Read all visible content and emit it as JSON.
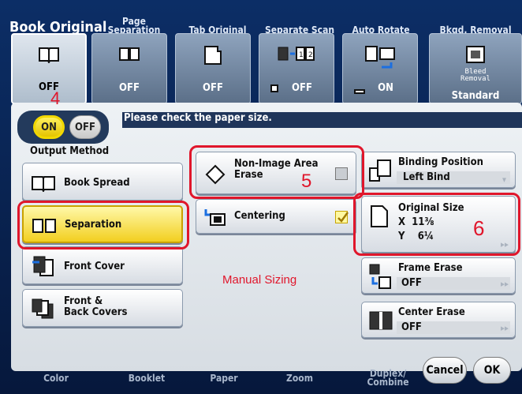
{
  "tabs": {
    "titles": [
      {
        "label": "Book Original"
      },
      {
        "label": "Page\nSeparation"
      },
      {
        "label": "Tab Original"
      },
      {
        "label": "Separate Scan"
      },
      {
        "label": "Auto Rotate"
      },
      {
        "label": "Bkgd. Removal"
      }
    ],
    "buttons": [
      {
        "state": "OFF",
        "icon": "book-icon"
      },
      {
        "state": "OFF",
        "icon": "page-separation-icon"
      },
      {
        "state": "OFF",
        "icon": "tab-original-icon"
      },
      {
        "state": "OFF",
        "icon": "separate-scan-icon"
      },
      {
        "state": "ON",
        "icon": "auto-rotate-icon"
      },
      {
        "state": "Standard",
        "icon": "bleed-removal-icon",
        "sublabel": "Bleed\nRemoval"
      }
    ]
  },
  "toggle": {
    "on": "ON",
    "off": "OFF"
  },
  "message": "Please check the paper size.",
  "output_method": {
    "label": "Output Method",
    "items": [
      {
        "label": "Book Spread"
      },
      {
        "label": "Separation"
      },
      {
        "label": "Front Cover"
      },
      {
        "label": "Front &\nBack Covers"
      }
    ]
  },
  "center": {
    "non_image_area_erase": "Non-Image Area\nErase",
    "centering": "Centering",
    "manual_sizing": "Manual Sizing"
  },
  "right": {
    "binding_position": {
      "title": "Binding Position",
      "value": "Left Bind"
    },
    "original_size": {
      "title": "Original Size",
      "x": "X  11⅜",
      "y": "Y    6¼"
    },
    "frame_erase": {
      "title": "Frame Erase",
      "value": "OFF"
    },
    "center_erase": {
      "title": "Center Erase",
      "value": "OFF"
    }
  },
  "annotations": {
    "a4": "4",
    "a5": "5",
    "a6": "6"
  },
  "bottom": {
    "tabs": [
      {
        "label": "Color"
      },
      {
        "label": "Booklet"
      },
      {
        "label": "Paper"
      },
      {
        "label": "Zoom"
      },
      {
        "label": "Duplex/\nCombine"
      }
    ],
    "cancel": "Cancel",
    "ok": "OK"
  },
  "colors": {
    "accent": "#f2cf20",
    "annotation": "#e0162b",
    "header": "#0c2e66"
  }
}
